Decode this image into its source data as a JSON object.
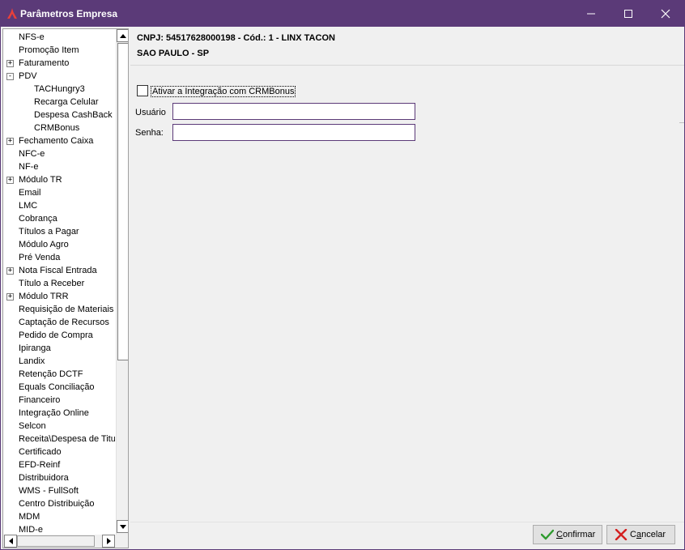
{
  "window": {
    "title": "Parâmetros Empresa",
    "accent_color": "#5b3a78",
    "logo_color": "#e8403a"
  },
  "header": {
    "company_line": "CNPJ: 54517628000198 - Cód.: 1 - LINX TACON",
    "location_line": "SAO PAULO - SP"
  },
  "tree": {
    "items": [
      {
        "label": "NFS-e",
        "level": 0,
        "expander": ""
      },
      {
        "label": "Promoção Item",
        "level": 0,
        "expander": ""
      },
      {
        "label": "Faturamento",
        "level": 0,
        "expander": "+"
      },
      {
        "label": "PDV",
        "level": 0,
        "expander": "-"
      },
      {
        "label": "TACHungry3",
        "level": 1,
        "expander": ""
      },
      {
        "label": "Recarga Celular",
        "level": 1,
        "expander": ""
      },
      {
        "label": "Despesa CashBack",
        "level": 1,
        "expander": ""
      },
      {
        "label": "CRMBonus",
        "level": 1,
        "expander": ""
      },
      {
        "label": "Fechamento Caixa",
        "level": 0,
        "expander": "+"
      },
      {
        "label": "NFC-e",
        "level": 0,
        "expander": ""
      },
      {
        "label": "NF-e",
        "level": 0,
        "expander": ""
      },
      {
        "label": "Módulo TR",
        "level": 0,
        "expander": "+"
      },
      {
        "label": "Email",
        "level": 0,
        "expander": ""
      },
      {
        "label": "LMC",
        "level": 0,
        "expander": ""
      },
      {
        "label": "Cobrança",
        "level": 0,
        "expander": ""
      },
      {
        "label": "Títulos a Pagar",
        "level": 0,
        "expander": ""
      },
      {
        "label": "Módulo Agro",
        "level": 0,
        "expander": ""
      },
      {
        "label": "Pré Venda",
        "level": 0,
        "expander": ""
      },
      {
        "label": "Nota Fiscal Entrada",
        "level": 0,
        "expander": "+"
      },
      {
        "label": "Título a Receber",
        "level": 0,
        "expander": ""
      },
      {
        "label": "Módulo TRR",
        "level": 0,
        "expander": "+"
      },
      {
        "label": "Requisição de Materiais",
        "level": 0,
        "expander": ""
      },
      {
        "label": "Captação de Recursos",
        "level": 0,
        "expander": ""
      },
      {
        "label": "Pedido de Compra",
        "level": 0,
        "expander": ""
      },
      {
        "label": "Ipiranga",
        "level": 0,
        "expander": ""
      },
      {
        "label": "Landix",
        "level": 0,
        "expander": ""
      },
      {
        "label": "Retenção DCTF",
        "level": 0,
        "expander": ""
      },
      {
        "label": "Equals Conciliação",
        "level": 0,
        "expander": ""
      },
      {
        "label": "Financeiro",
        "level": 0,
        "expander": ""
      },
      {
        "label": "Integração Online",
        "level": 0,
        "expander": ""
      },
      {
        "label": "Selcon",
        "level": 0,
        "expander": ""
      },
      {
        "label": "Receita\\Despesa de Titul",
        "level": 0,
        "expander": ""
      },
      {
        "label": "Certificado",
        "level": 0,
        "expander": ""
      },
      {
        "label": "EFD-Reinf",
        "level": 0,
        "expander": ""
      },
      {
        "label": "Distribuidora",
        "level": 0,
        "expander": ""
      },
      {
        "label": "WMS - FullSoft",
        "level": 0,
        "expander": ""
      },
      {
        "label": "Centro Distribuição",
        "level": 0,
        "expander": ""
      },
      {
        "label": "MDM",
        "level": 0,
        "expander": ""
      },
      {
        "label": "MID-e",
        "level": 0,
        "expander": ""
      }
    ]
  },
  "form": {
    "checkbox_label": "Ativar a Integração com CRMBonus",
    "checkbox_checked": false,
    "usuario_label": "Usuário",
    "usuario_value": "",
    "senha_label": "Senha:",
    "senha_value": ""
  },
  "buttons": {
    "confirm_pre": "",
    "confirm_ul": "C",
    "confirm_post": "onfirmar",
    "cancel_pre": "C",
    "cancel_ul": "a",
    "cancel_post": "ncelar"
  }
}
